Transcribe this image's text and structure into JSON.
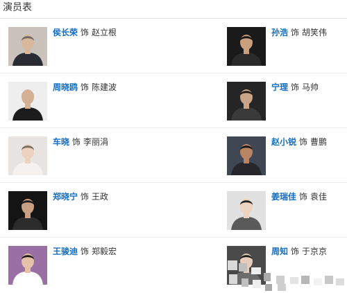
{
  "section": {
    "title": "演员表"
  },
  "cast": [
    [
      {
        "actor": "侯长荣",
        "as": "饰",
        "role": "赵立根",
        "photo_bg": "#c9c3bb",
        "coat": "#2a2c33",
        "skin": "#d8b79a",
        "hair": "#6e6660"
      },
      {
        "actor": "孙浩",
        "as": "饰",
        "role": "胡笑伟",
        "photo_bg": "#1a1a1a",
        "coat": "#2b2b2b",
        "skin": "#c99f7e",
        "hair": "#111111"
      }
    ],
    [
      {
        "actor": "周晓鸥",
        "as": "饰",
        "role": "陈建波",
        "photo_bg": "#eeeeee",
        "coat": "#1c1c1c",
        "skin": "#d4b094",
        "hair": "#d4b094"
      },
      {
        "actor": "宁理",
        "as": "饰",
        "role": "马帅",
        "photo_bg": "#252525",
        "coat": "#3a3a3a",
        "skin": "#caa486",
        "hair": "#161616"
      }
    ],
    [
      {
        "actor": "车晓",
        "as": "饰",
        "role": "李丽涓",
        "photo_bg": "#e7e4e2",
        "coat": "#f4f1ee",
        "skin": "#ecd2bf",
        "hair": "#7b6b5f"
      },
      {
        "actor": "赵小锐",
        "as": "饰",
        "role": "曹鹏",
        "photo_bg": "#3f4654",
        "coat": "#26262b",
        "skin": "#b98463",
        "hair": "#151515"
      }
    ],
    [
      {
        "actor": "郑晓宁",
        "as": "饰",
        "role": "王政",
        "photo_bg": "#141414",
        "coat": "#2c2c2c",
        "skin": "#c89f82",
        "hair": "#1b1b1b"
      },
      {
        "actor": "姜瑞佳",
        "as": "饰",
        "role": "袁佳",
        "photo_bg": "#e1e1e1",
        "coat": "#5a5a5a",
        "skin": "#ecd3c2",
        "hair": "#222222"
      }
    ],
    [
      {
        "actor": "王骏迪",
        "as": "饰",
        "role": "郑毅宏",
        "photo_bg": "#9a6fa3",
        "coat": "#ffffff",
        "skin": "#e3c0a6",
        "hair": "#1a1a1a"
      },
      {
        "actor": "周知",
        "as": "饰",
        "role": "于京京",
        "photo_bg": "#4a4a4a",
        "coat": "#6c6c6c",
        "skin": "#e6cdbb",
        "hair": "#1c1c1c"
      }
    ]
  ],
  "mosaic_colors": [
    "#d9d9d9",
    "#bfbfbf",
    "#eeeeee",
    "#a9a9a9",
    "#cfcfcf",
    "#e5e5e5",
    "#b7b7b7",
    "#f2f2f2",
    "#c8c8c8",
    "#dcdcdc"
  ]
}
